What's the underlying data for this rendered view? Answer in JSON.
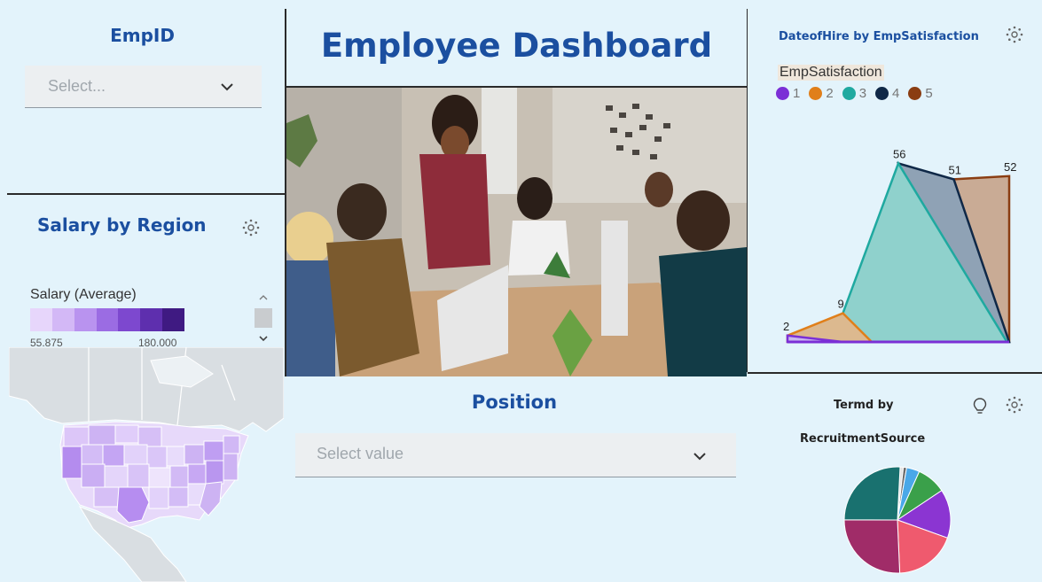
{
  "empid": {
    "title": "EmpID",
    "placeholder": "Select..."
  },
  "salary": {
    "title": "Salary by Region",
    "legend_title": "Salary (Average)",
    "min_label": "55.875",
    "max_label": "180.000",
    "ramp_colors": [
      "#e7d6fb",
      "#d3b8f6",
      "#b993ef",
      "#9b6ce3",
      "#7d48cf",
      "#5e2fae",
      "#3f1a82"
    ]
  },
  "header": {
    "title": "Employee Dashboard"
  },
  "position": {
    "title": "Position",
    "placeholder": "Select value"
  },
  "line": {
    "title": "DateofHire by EmpSatisfaction",
    "legend_title": "EmpSatisfaction",
    "legend": [
      {
        "label": "1",
        "color": "#7b2fd6"
      },
      {
        "label": "2",
        "color": "#e07f1a"
      },
      {
        "label": "3",
        "color": "#1fa9a0"
      },
      {
        "label": "4",
        "color": "#0f2847"
      },
      {
        "label": "5",
        "color": "#8a3d12"
      }
    ]
  },
  "pie": {
    "title_line1": "Termd by",
    "title_line2": "RecruitmentSource"
  },
  "chart_data": [
    {
      "type": "area",
      "title": "DateofHire by EmpSatisfaction",
      "categories": [
        "1",
        "2",
        "3",
        "4",
        "5"
      ],
      "values": [
        2,
        9,
        56,
        51,
        52
      ],
      "data_labels": [
        "2",
        "9",
        "56",
        "51",
        "52"
      ],
      "ylim": [
        0,
        60
      ],
      "legend_placement": "top-left",
      "grid": false
    },
    {
      "type": "pie",
      "title": "Termd by RecruitmentSource",
      "slices": [
        {
          "value": 1,
          "color": "#e2e2e2"
        },
        {
          "value": 1,
          "color": "#6b6b6b"
        },
        {
          "value": 4,
          "color": "#4aa8e8"
        },
        {
          "value": 9,
          "color": "#3aa04a"
        },
        {
          "value": 15,
          "color": "#8b35d2"
        },
        {
          "value": 19,
          "color": "#ef5a6e"
        },
        {
          "value": 26,
          "color": "#a02c68"
        },
        {
          "value": 26,
          "color": "#19716f"
        }
      ]
    }
  ]
}
